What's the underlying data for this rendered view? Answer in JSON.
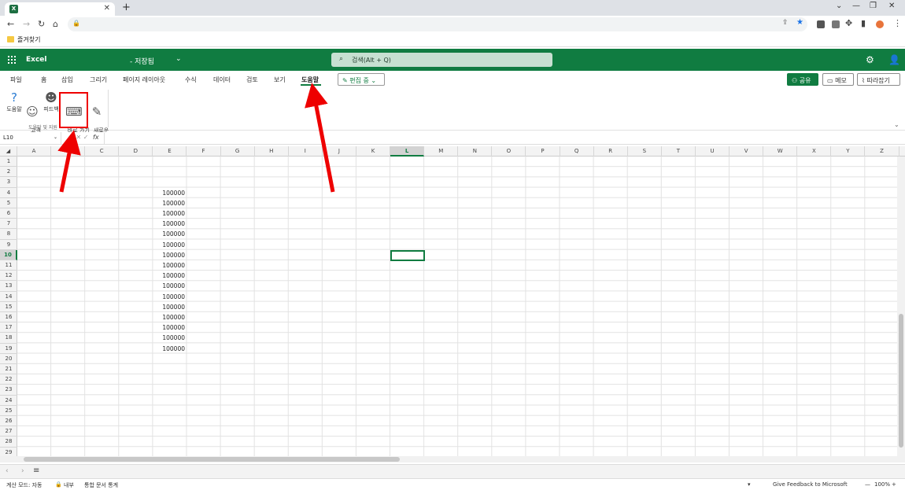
{
  "browser": {
    "tab_title": "",
    "new_tab": "+",
    "bookmark_folder": "즐겨찾기"
  },
  "excel": {
    "app_name": "Excel",
    "doc_status": "- 저장됨",
    "search_placeholder": "검색(Alt + Q)"
  },
  "menu": {
    "items": [
      "파일",
      "홈",
      "삽입",
      "그리기",
      "페이지 레이아웃",
      "수식",
      "데이터",
      "검토",
      "보기",
      "도움말"
    ],
    "active": "도움말",
    "edit_mode": "✎ 편집 중 ⌄",
    "share": "공유",
    "memo": "메모",
    "follow": "따라잡기"
  },
  "ribbon": {
    "help": "도움말",
    "support": "고객\n지원",
    "feedback": "피드백",
    "shortcuts": "바로 가기\n키",
    "whats_new": "새로운\n기능",
    "group_label": "도움말 및 지원"
  },
  "formula_bar": {
    "name_box": "L10",
    "fx": "fx"
  },
  "columns": [
    "A",
    "B",
    "C",
    "D",
    "E",
    "F",
    "G",
    "H",
    "I",
    "J",
    "K",
    "L",
    "M",
    "N",
    "O",
    "P",
    "Q",
    "R",
    "S",
    "T",
    "U",
    "V",
    "W",
    "X",
    "Y",
    "Z"
  ],
  "selected_column": "L",
  "selected_row": 10,
  "rows": [
    1,
    2,
    3,
    4,
    5,
    6,
    7,
    8,
    9,
    10,
    11,
    12,
    13,
    14,
    15,
    16,
    17,
    18,
    19,
    20,
    21,
    22,
    23,
    24,
    25,
    26,
    27,
    28,
    29
  ],
  "column_e_values": {
    "4": "100000",
    "5": "100000",
    "6": "100000",
    "7": "100000",
    "8": "100000",
    "9": "100000",
    "10": "100000",
    "11": "100000",
    "12": "100000",
    "13": "100000",
    "14": "100000",
    "15": "100000",
    "16": "100000",
    "17": "100000",
    "18": "100000",
    "19": "100000"
  },
  "status_bar": {
    "calc_mode": "계산 모드: 자동",
    "internal": "내부",
    "workbook_stats": "통합 문서 통계",
    "feedback": "Give Feedback to Microsoft",
    "zoom": "100%"
  },
  "accent_color": "#107c41",
  "annotation_color": "#e00000"
}
